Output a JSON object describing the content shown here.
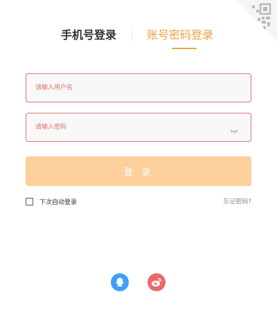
{
  "tabs": {
    "phone_login": "手机号登录",
    "account_login": "账号密码登录"
  },
  "form": {
    "username_placeholder": "请输入用户名",
    "password_placeholder": "请输入密码",
    "login_button": "登 录",
    "remember_label": "下次自动登录",
    "remember_checked": false,
    "forgot_link": "忘记密码?"
  },
  "social": [
    "qq-icon",
    "weibo-icon"
  ],
  "colors": {
    "accent": "#f0a045",
    "button": "#fdd09c",
    "error_border": "#e07070",
    "qq": "#3d9ff5",
    "weibo": "#e86a6a"
  }
}
